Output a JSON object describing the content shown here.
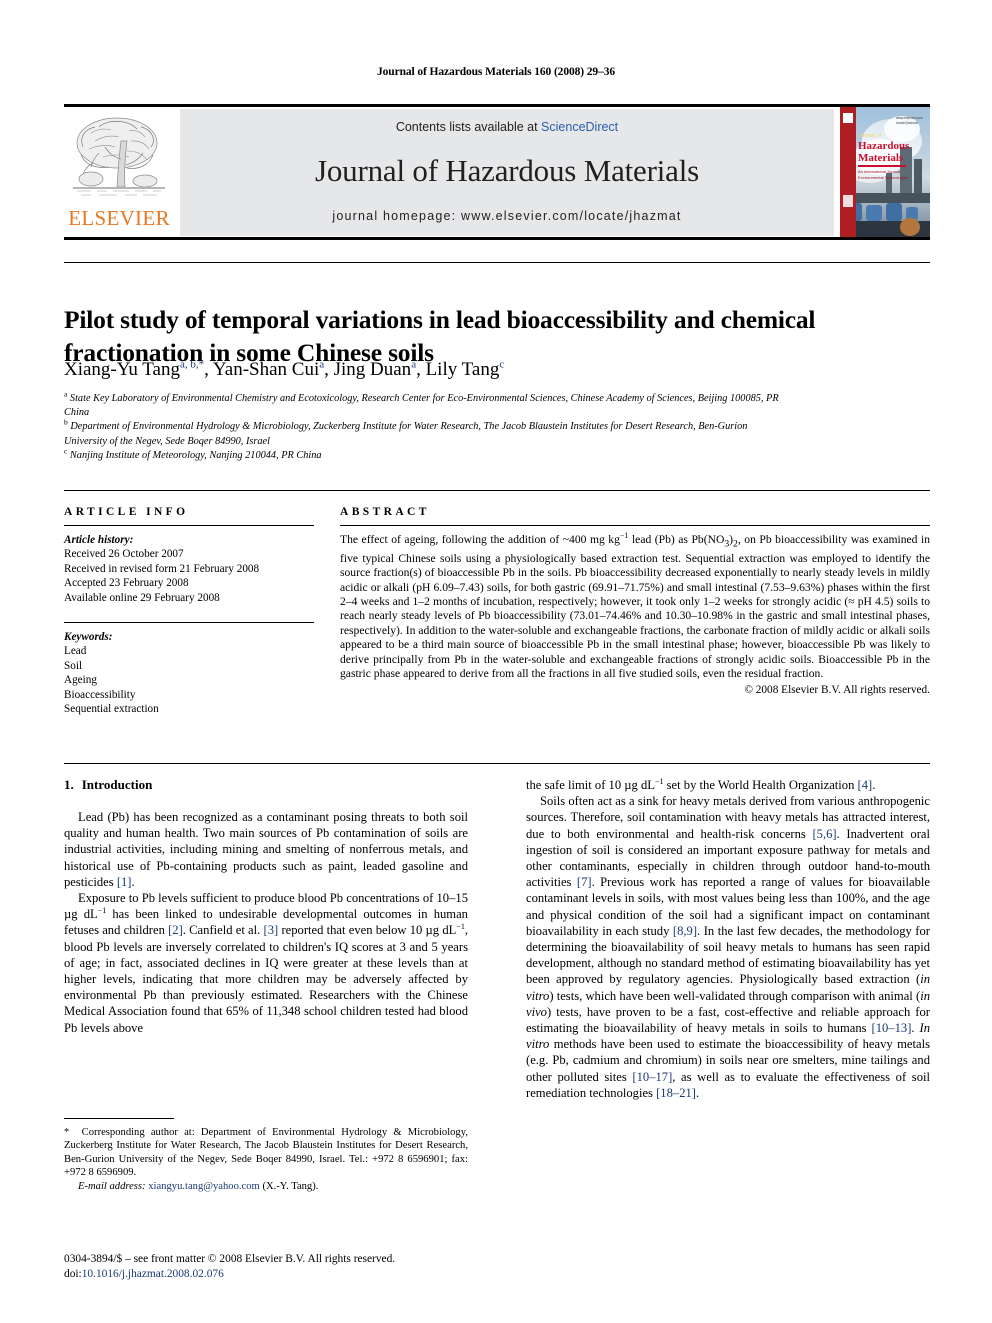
{
  "running_head": "Journal of Hazardous Materials 160 (2008) 29–36",
  "masthead": {
    "contents_prefix": "Contents lists available at ",
    "sciencedirect": "ScienceDirect",
    "journal_title": "Journal of Hazardous Materials",
    "homepage": "journal homepage: www.elsevier.com/locate/jhazmat",
    "publisher_logo_text": "ELSEVIER",
    "cover_title_line1": "Journal of",
    "cover_title_line2": "Hazardous",
    "cover_title_line3": "Materials",
    "accent_orange": "#E87722",
    "link_blue": "#2b5eaa",
    "band_gray": "#e6e7e8"
  },
  "title": "Pilot study of temporal variations in lead bioaccessibility and chemical fractionation in some Chinese soils",
  "authors_html": "Xiang-Yu Tang<sup>a, b,*</sup>, Yan-Shan Cui<sup>a</sup>, Jing Duan<sup>a</sup>, Lily Tang<sup>c</sup>",
  "affiliations": [
    {
      "marker": "a",
      "text": "State Key Laboratory of Environmental Chemistry and Ecotoxicology, Research Center for Eco-Environmental Sciences, Chinese Academy of Sciences, Beijing 100085, PR China"
    },
    {
      "marker": "b",
      "text": "Department of Environmental Hydrology & Microbiology, Zuckerberg Institute for Water Research, The Jacob Blaustein Institutes for Desert Research, Ben-Gurion University of the Negev, Sede Boqer 84990, Israel"
    },
    {
      "marker": "c",
      "text": "Nanjing Institute of Meteorology, Nanjing 210044, PR China"
    }
  ],
  "article_info": {
    "heading": "ARTICLE INFO",
    "history_label": "Article history:",
    "history": [
      "Received 26 October 2007",
      "Received in revised form 21 February 2008",
      "Accepted 23 February 2008",
      "Available online 29 February 2008"
    ],
    "keywords_label": "Keywords:",
    "keywords": [
      "Lead",
      "Soil",
      "Ageing",
      "Bioaccessibility",
      "Sequential extraction"
    ]
  },
  "abstract": {
    "heading": "ABSTRACT",
    "text_html": "The effect of ageing, following the addition of ~400 mg kg<sup class=\"small\">−1</sup> lead (Pb) as Pb(NO<sub>3</sub>)<sub>2</sub>, on Pb bioaccessibility was examined in five typical Chinese soils using a physiologically based extraction test. Sequential extraction was employed to identify the source fraction(s) of bioaccessible Pb in the soils. Pb bioaccessibility decreased exponentially to nearly steady levels in mildly acidic or alkali (pH 6.09–7.43) soils, for both gastric (69.91–71.75%) and small intestinal (7.53–9.63%) phases within the first 2–4 weeks and 1–2 months of incubation, respectively; however, it took only 1–2 weeks for strongly acidic (≈ pH 4.5) soils to reach nearly steady levels of Pb bioaccessibility (73.01–74.46% and 10.30–10.98% in the gastric and small intestinal phases, respectively). In addition to the water-soluble and exchangeable fractions, the carbonate fraction of mildly acidic or alkali soils appeared to be a third main source of bioaccessible Pb in the small intestinal phase; however, bioaccessible Pb was likely to derive principally from Pb in the water-soluble and exchangeable fractions of strongly acidic soils. Bioaccessible Pb in the gastric phase appeared to derive from all the fractions in all five studied soils, even the residual fraction.",
    "copyright": "© 2008 Elsevier B.V. All rights reserved."
  },
  "intro": {
    "number": "1.",
    "heading": "Introduction",
    "p1_html": "Lead (Pb) has been recognized as a contaminant posing threats to both soil quality and human health. Two main sources of Pb contamination of soils are industrial activities, including mining and smelting of nonferrous metals, and historical use of Pb-containing products such as paint, leaded gasoline and pesticides <span class=\"ref\">[1]</span>.",
    "p2_html": "Exposure to Pb levels sufficient to produce blood Pb concentrations of 10–15 µg dL<sup class=\"small\">−1</sup> has been linked to undesirable developmental outcomes in human fetuses and children <span class=\"ref\">[2]</span>. Canfield et al. <span class=\"ref\">[3]</span> reported that even below 10 µg dL<sup class=\"small\">−1</sup>, blood Pb levels are inversely correlated to children's IQ scores at 3 and 5 years of age; in fact, associated declines in IQ were greater at these levels than at higher levels, indicating that more children may be adversely affected by environmental Pb than previously estimated. Researchers with the Chinese Medical Association found that 65% of 11,348 school children tested had blood Pb levels above",
    "p2_cont_html": "the safe limit of 10 µg dL<sup class=\"small\">−1</sup> set by the World Health Organization <span class=\"ref\">[4]</span>.",
    "p3_html": "Soils often act as a sink for heavy metals derived from various anthropogenic sources. Therefore, soil contamination with heavy metals has attracted interest, due to both environmental and health-risk concerns <span class=\"ref\">[5,6]</span>. Inadvertent oral ingestion of soil is considered an important exposure pathway for metals and other contaminants, especially in children through outdoor hand-to-mouth activities <span class=\"ref\">[7]</span>. Previous work has reported a range of values for bioavailable contaminant levels in soils, with most values being less than 100%, and the age and physical condition of the soil had a significant impact on contaminant bioavailability in each study <span class=\"ref\">[8,9]</span>. In the last few decades, the methodology for determining the bioavailability of soil heavy metals to humans has seen rapid development, although no standard method of estimating bioavailability has yet been approved by regulatory agencies. Physiologically based extraction (<i>in vitro</i>) tests, which have been well-validated through comparison with animal (<i>in vivo</i>) tests, have proven to be a fast, cost-effective and reliable approach for estimating the bioavailability of heavy metals in soils to humans <span class=\"ref\">[10–13]</span>. <i>In vitro</i> methods have been used to estimate the bioaccessibility of heavy metals (e.g. Pb, cadmium and chromium) in soils near ore smelters, mine tailings and other polluted sites <span class=\"ref\">[10–17]</span>, as well as to evaluate the effectiveness of soil remediation technologies <span class=\"ref\">[18–21]</span>."
  },
  "footnote": {
    "corresponding_html": "<span class=\"star\">*</span>&nbsp; Corresponding author at: Department of Environmental Hydrology &amp; Microbiology, Zuckerberg Institute for Water Research, The Jacob Blaustein Institutes for Desert Research, Ben-Gurion University of the Negev, Sede Boqer 84990, Israel. Tel.: +972 8 6596901; fax: +972 8 6596909.",
    "email_label": "E-mail address:",
    "email": "xiangyu.tang@yahoo.com",
    "email_suffix": "(X.-Y. Tang)."
  },
  "imprint": {
    "line1_html": "0304-3894/$ – see front matter © 2008 Elsevier B.V. All rights reserved.",
    "doi_label": "doi:",
    "doi": "10.1016/j.jhazmat.2008.02.076"
  }
}
